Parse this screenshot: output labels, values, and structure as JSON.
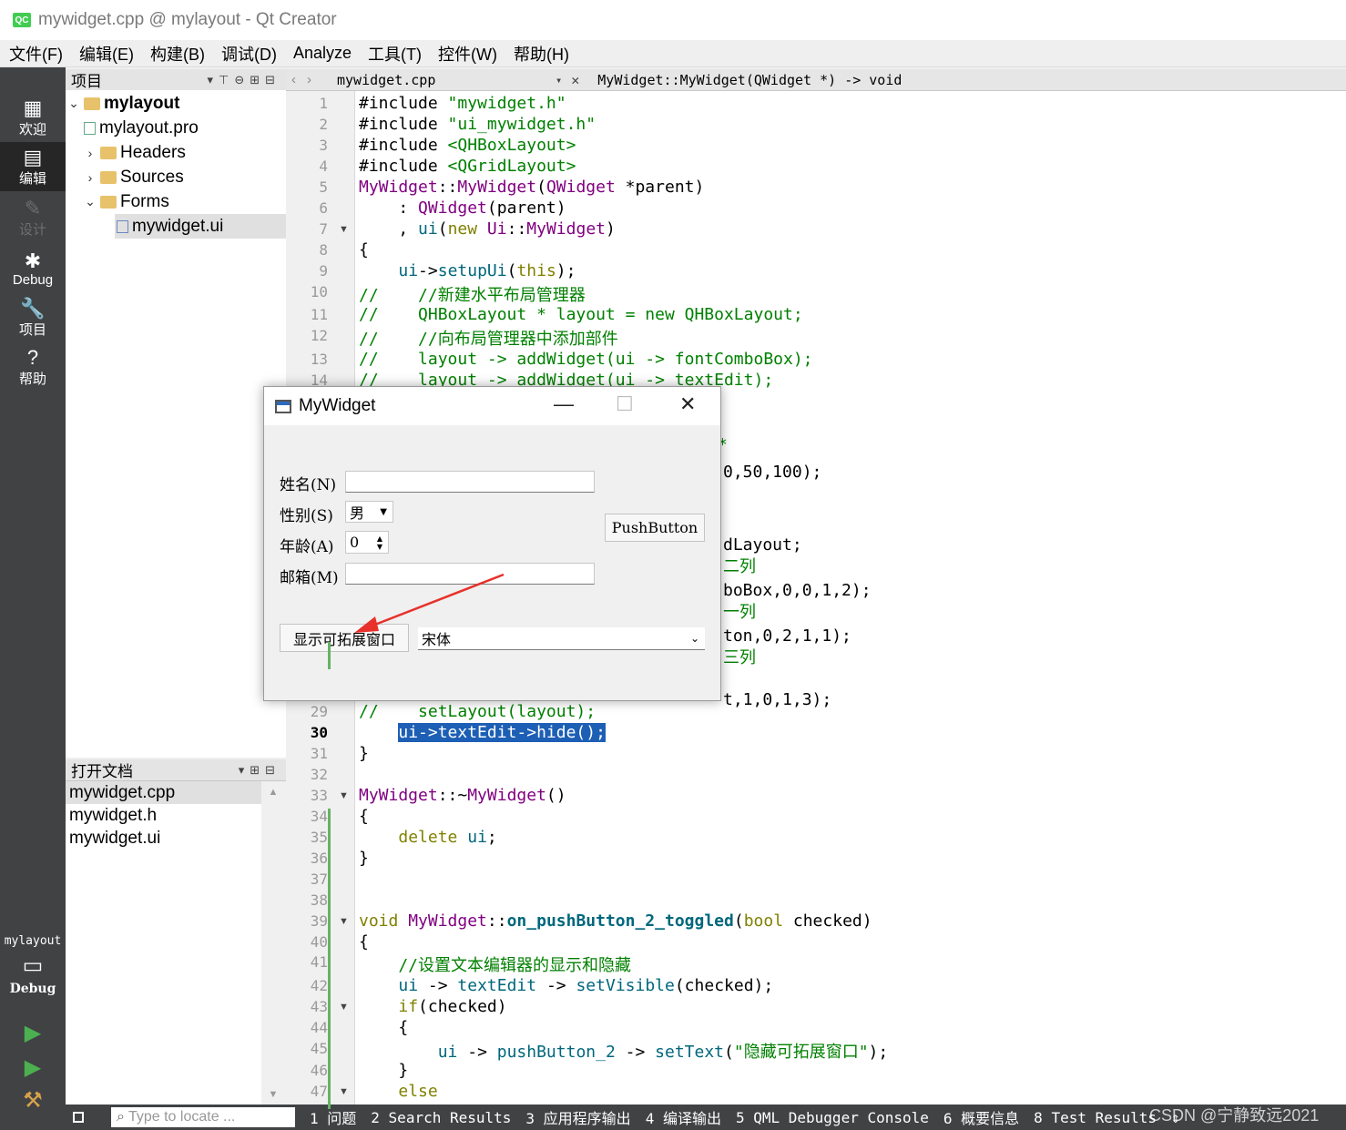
{
  "window": {
    "title": "mywidget.cpp @ mylayout - Qt Creator",
    "logo": "QC"
  },
  "menu": [
    "文件(F)",
    "编辑(E)",
    "构建(B)",
    "调试(D)",
    "Analyze",
    "工具(T)",
    "控件(W)",
    "帮助(H)"
  ],
  "modes": [
    {
      "label": "欢迎",
      "icon": "grid-icon"
    },
    {
      "label": "编辑",
      "icon": "edit-icon"
    },
    {
      "label": "设计",
      "icon": "pencil-icon"
    },
    {
      "label": "Debug",
      "icon": "bug-icon"
    },
    {
      "label": "项目",
      "icon": "wrench-icon"
    },
    {
      "label": "帮助",
      "icon": "help-icon"
    }
  ],
  "kit": {
    "project": "mylayout",
    "config": "Debug"
  },
  "project_panel": {
    "title": "项目",
    "tree": [
      {
        "label": "mylayout",
        "level": 0,
        "expanded": true,
        "bold": true
      },
      {
        "label": "mylayout.pro",
        "level": 1
      },
      {
        "label": "Headers",
        "level": 1,
        "expanded": false
      },
      {
        "label": "Sources",
        "level": 1,
        "expanded": false
      },
      {
        "label": "Forms",
        "level": 1,
        "expanded": true
      },
      {
        "label": "mywidget.ui",
        "level": 2,
        "selected": true
      }
    ]
  },
  "open_docs": {
    "title": "打开文档",
    "items": [
      "mywidget.cpp",
      "mywidget.h",
      "mywidget.ui"
    ]
  },
  "editor_toolbar": {
    "file": "mywidget.cpp",
    "function": "MyWidget::MyWidget(QWidget *) -> void"
  },
  "code_lines": [
    {
      "n": "1",
      "text": "#include \"mywidget.h\""
    },
    {
      "n": "2",
      "text": "#include \"ui_mywidget.h\""
    },
    {
      "n": "3",
      "text": "#include <QHBoxLayout>"
    },
    {
      "n": "4",
      "text": "#include <QGridLayout>"
    },
    {
      "n": "5",
      "text": "MyWidget::MyWidget(QWidget *parent)"
    },
    {
      "n": "6",
      "text": "    : QWidget(parent)"
    },
    {
      "n": "7",
      "text": "    , ui(new Ui::MyWidget)"
    },
    {
      "n": "8",
      "text": "{"
    },
    {
      "n": "9",
      "text": "    ui->setupUi(this);"
    },
    {
      "n": "10",
      "text": "//    //新建水平布局管理器"
    },
    {
      "n": "11",
      "text": "//    QHBoxLayout * layout = new QHBoxLayout;"
    },
    {
      "n": "12",
      "text": "//    //向布局管理器中添加部件"
    },
    {
      "n": "13",
      "text": "//    layout -> addWidget(ui -> fontComboBox);"
    },
    {
      "n": "14",
      "text": "//    layout -> addWidget(ui -> textEdit);"
    },
    {
      "n": "29",
      "text": "//    setLayout(layout);"
    },
    {
      "n": "30",
      "text": "    ui->textEdit->hide();"
    },
    {
      "n": "31",
      "text": "}"
    },
    {
      "n": "32",
      "text": ""
    },
    {
      "n": "33",
      "text": "MyWidget::~MyWidget()"
    },
    {
      "n": "34",
      "text": "{"
    },
    {
      "n": "35",
      "text": "    delete ui;"
    },
    {
      "n": "36",
      "text": "}"
    },
    {
      "n": "37",
      "text": ""
    },
    {
      "n": "38",
      "text": ""
    },
    {
      "n": "39",
      "text": "void MyWidget::on_pushButton_2_toggled(bool checked)"
    },
    {
      "n": "40",
      "text": "{"
    },
    {
      "n": "41",
      "text": "    //设置文本编辑器的显示和隐藏"
    },
    {
      "n": "42",
      "text": "    ui -> textEdit -> setVisible(checked);"
    },
    {
      "n": "43",
      "text": "    if(checked)"
    },
    {
      "n": "44",
      "text": "    {"
    },
    {
      "n": "45",
      "text": "        ui -> pushButton_2 -> setText(\"隐藏可拓展窗口\");"
    },
    {
      "n": "46",
      "text": "    }"
    },
    {
      "n": "47",
      "text": "    else"
    }
  ],
  "code_fragments": [
    "*",
    "0,50,100);",
    "dLayout;",
    "二列",
    "boBox,0,0,1,2);",
    "一列",
    "ton,0,2,1,1);",
    "三列",
    "t,1,0,1,3);"
  ],
  "dialog": {
    "title": "MyWidget",
    "labels": {
      "name": "姓名(N)",
      "gender": "性别(S)",
      "age": "年龄(A)",
      "email": "邮箱(M)"
    },
    "gender_value": "男",
    "age_value": "0",
    "push_button": "PushButton",
    "toggle_button": "显示可拓展窗口",
    "font_combo": "宋体"
  },
  "status_bar": {
    "locate_placeholder": "Type to locate ...",
    "tabs": [
      "1 问题",
      "2 Search Results",
      "3 应用程序输出",
      "4 编译输出",
      "5 QML Debugger Console",
      "6 概要信息",
      "8 Test Results"
    ],
    "watermark": "CSDN @宁静致远2021"
  }
}
